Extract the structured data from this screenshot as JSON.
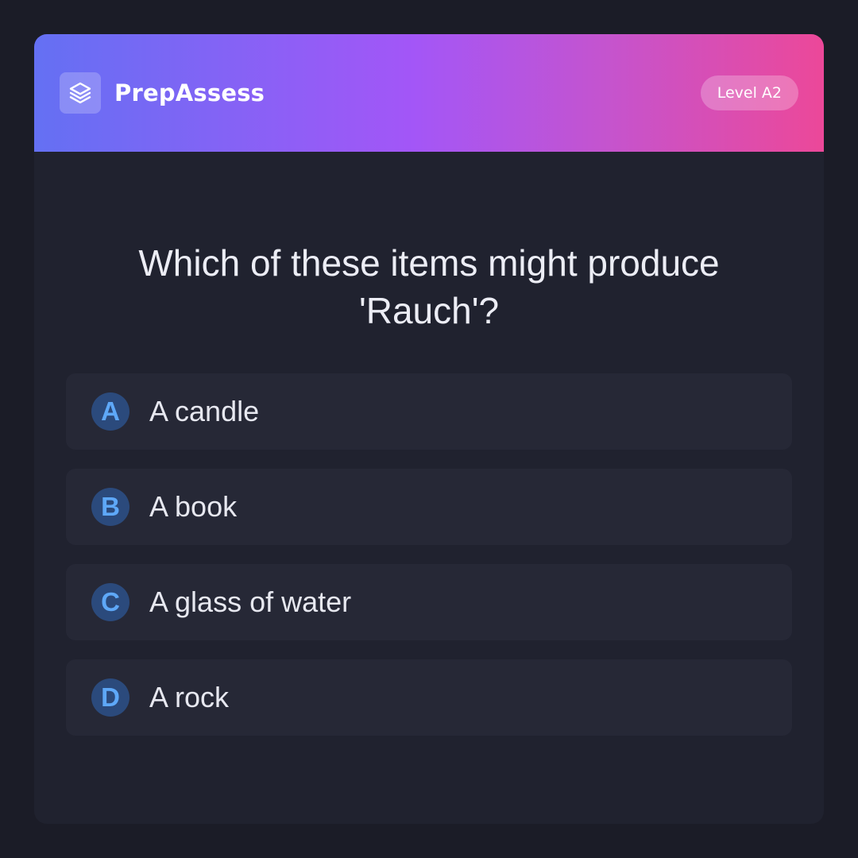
{
  "header": {
    "brand_name": "PrepAssess",
    "level_badge": "Level A2",
    "logo_icon": "layers-icon",
    "gradient_colors": [
      "#6470f3",
      "#a356f7",
      "#ec4899"
    ]
  },
  "question": {
    "text": "Which of these items might produce 'Rauch'?"
  },
  "options": [
    {
      "letter": "A",
      "text": "A candle"
    },
    {
      "letter": "B",
      "text": "A book"
    },
    {
      "letter": "C",
      "text": "A glass of water"
    },
    {
      "letter": "D",
      "text": "A rock"
    }
  ],
  "colors": {
    "page_background": "#1b1c27",
    "card_background": "#20222f",
    "option_background": "#262836",
    "letter_circle": "#2b4a7c",
    "letter_text": "#5ea8f8"
  }
}
